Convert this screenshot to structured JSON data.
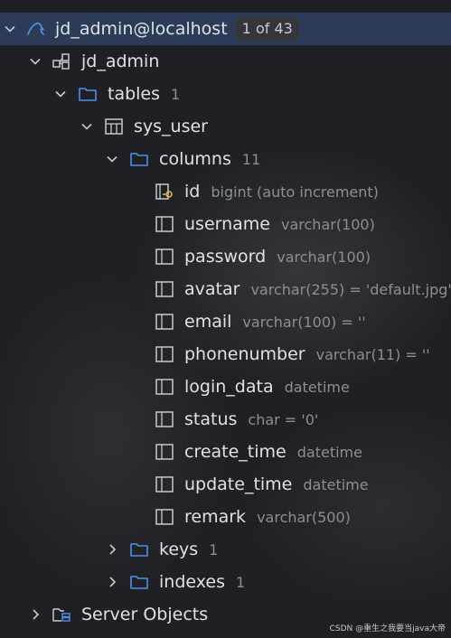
{
  "tree": {
    "connection": {
      "name": "jd_admin@localhost",
      "badge": "1 of 43",
      "icon": "mysql-icon"
    },
    "schema": {
      "name": "jd_admin",
      "icon": "schema-icon"
    },
    "tables_folder": {
      "name": "tables",
      "count": "1",
      "icon": "folder-icon"
    },
    "table": {
      "name": "sys_user",
      "icon": "table-icon"
    },
    "columns_folder": {
      "name": "columns",
      "count": "11",
      "icon": "folder-icon"
    },
    "columns": [
      {
        "name": "id",
        "type": "bigint (auto increment)",
        "icon": "primary-key-column-icon"
      },
      {
        "name": "username",
        "type": "varchar(100)",
        "icon": "column-icon"
      },
      {
        "name": "password",
        "type": "varchar(100)",
        "icon": "column-icon"
      },
      {
        "name": "avatar",
        "type": "varchar(255) = 'default.jpg'",
        "icon": "column-icon"
      },
      {
        "name": "email",
        "type": "varchar(100) = ''",
        "icon": "column-icon"
      },
      {
        "name": "phonenumber",
        "type": "varchar(11) = ''",
        "icon": "column-icon"
      },
      {
        "name": "login_data",
        "type": "datetime",
        "icon": "column-icon"
      },
      {
        "name": "status",
        "type": "char = '0'",
        "icon": "column-icon"
      },
      {
        "name": "create_time",
        "type": "datetime",
        "icon": "column-icon"
      },
      {
        "name": "update_time",
        "type": "datetime",
        "icon": "column-icon"
      },
      {
        "name": "remark",
        "type": "varchar(500)",
        "icon": "column-icon"
      }
    ],
    "keys_folder": {
      "name": "keys",
      "count": "1",
      "icon": "folder-icon"
    },
    "indexes_folder": {
      "name": "indexes",
      "count": "1",
      "icon": "folder-icon"
    },
    "server_objects": {
      "name": "Server Objects",
      "icon": "server-objects-icon"
    }
  },
  "watermark": "CSDN @重生之我要当java大帝",
  "colors": {
    "background": "#1f2024",
    "selection": "#2b3b58",
    "folder": "#4f8fe8",
    "text": "#dfe1e5",
    "meta": "#8b8e94"
  }
}
